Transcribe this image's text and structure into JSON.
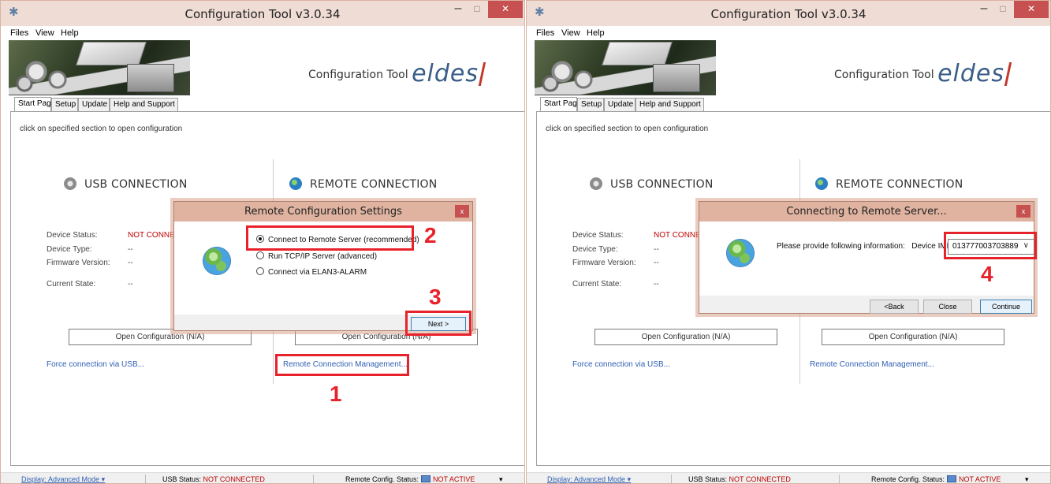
{
  "window": {
    "title": "Configuration Tool v3.0.34",
    "menu": [
      "Files",
      "View",
      "Help"
    ],
    "banner_title": "Configuration Tool",
    "logo": "eldes",
    "tabs": [
      "Start Page",
      "Setup",
      "Update",
      "Help and Support"
    ],
    "hint": "click on specified section to open configuration",
    "usb": {
      "heading": "USB CONNECTION",
      "device_status_label": "Device Status:",
      "device_status_value": "NOT CONNECTED",
      "device_type_label": "Device Type:",
      "device_type_value": "--",
      "firmware_label": "Firmware Version:",
      "firmware_value": "--",
      "state_label": "Current State:",
      "state_value": "--",
      "open_button": "Open Configuration (N/A)",
      "force_link": "Force connection via USB..."
    },
    "remote": {
      "heading": "REMOTE CONNECTION",
      "open_button": "Open Configuration (N/A)",
      "manage_link": "Remote Connection Management..."
    },
    "status": {
      "display_mode": "Display: Advanced Mode",
      "usb_label": "USB Status:",
      "usb_value": "NOT CONNECTED",
      "remote_label": "Remote Config. Status:",
      "remote_value": "NOT ACTIVE"
    },
    "controls": {
      "minimize": "–",
      "maximize": "□",
      "close": "✕",
      "dropdown": "▾",
      "app_icon": "✱"
    }
  },
  "dialog_settings": {
    "title": "Remote Configuration Settings",
    "close": "x",
    "options": [
      "Connect to Remote Server (recommended)",
      "Run TCP/IP Server (advanced)",
      "Connect via ELAN3-ALARM"
    ],
    "selected_index": 0,
    "next_button": "Next >"
  },
  "dialog_connecting": {
    "title": "Connecting to Remote Server...",
    "close": "x",
    "prompt": "Please provide following information:",
    "imei_label": "Device IMEI:",
    "imei_value": "013777003703889",
    "chevron": "∨",
    "back_button": "<Back",
    "close_button": "Close",
    "continue_button": "Continue"
  },
  "annotations": [
    "1",
    "2",
    "3",
    "4"
  ],
  "colors": {
    "titlebar": "#efdcd4",
    "dialog_title": "#dfb3a0",
    "highlight": "#e8222b",
    "error_text": "#c00000",
    "link": "#2f5fb3"
  }
}
